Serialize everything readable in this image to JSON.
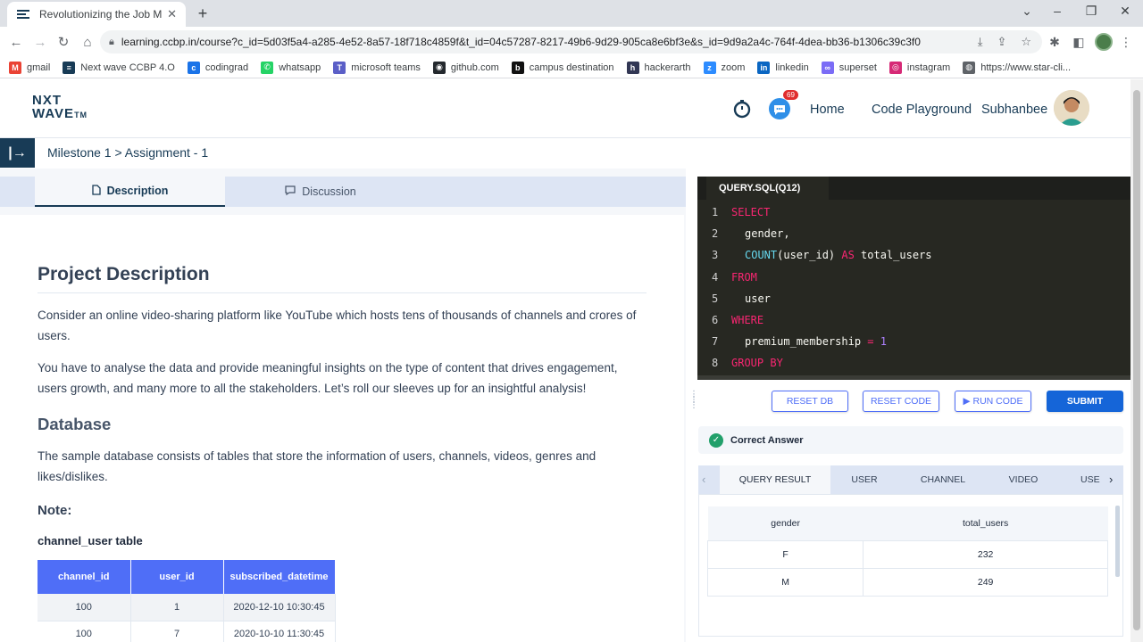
{
  "browser": {
    "tab_title": "Revolutionizing the Job Market |",
    "tab_close": "✕",
    "new_tab": "+",
    "url": "learning.ccbp.in/course?c_id=5d03f5a4-a285-4e52-8a57-18f718c4859f&t_id=04c57287-8217-49b6-9d29-905ca8e6bf3e&s_id=9d9a2a4c-764f-4dea-bb36-b1306c39c3f0",
    "bookmarks": [
      {
        "label": "gmail",
        "icon": "gmail-icon",
        "color": "#ea4335",
        "glyph": "M"
      },
      {
        "label": "Next wave CCBP 4.O",
        "icon": "nxtwave-icon",
        "color": "#183b56",
        "glyph": "≡"
      },
      {
        "label": "codingrad",
        "icon": "codingrad-icon",
        "color": "#1a73e8",
        "glyph": "c"
      },
      {
        "label": "whatsapp",
        "icon": "whatsapp-icon",
        "color": "#25d366",
        "glyph": "✆"
      },
      {
        "label": "microsoft teams",
        "icon": "teams-icon",
        "color": "#5b5fc7",
        "glyph": "T"
      },
      {
        "label": "github.com",
        "icon": "github-icon",
        "color": "#24292e",
        "glyph": "◉"
      },
      {
        "label": "campus destination",
        "icon": "campus-icon",
        "color": "#111111",
        "glyph": "b"
      },
      {
        "label": "hackerarth",
        "icon": "hackerearth-icon",
        "color": "#323754",
        "glyph": "h"
      },
      {
        "label": "zoom",
        "icon": "zoom-icon",
        "color": "#2d8cff",
        "glyph": "z"
      },
      {
        "label": "linkedin",
        "icon": "linkedin-icon",
        "color": "#0a66c2",
        "glyph": "in"
      },
      {
        "label": "superset",
        "icon": "superset-icon",
        "color": "#7b6cf6",
        "glyph": "∞"
      },
      {
        "label": "instagram",
        "icon": "instagram-icon",
        "color": "#d62976",
        "glyph": "◎"
      },
      {
        "label": "https://www.star-cli...",
        "icon": "globe-icon",
        "color": "#5f6368",
        "glyph": "◍"
      }
    ]
  },
  "header": {
    "logo_top": "NXT",
    "logo_bottom": "WAVE",
    "logo_tm": "TM",
    "chat_badge": "69",
    "nav_home": "Home",
    "nav_playground": "Code Playground",
    "user_name": "Subhanbee"
  },
  "breadcrumb": {
    "text": "Milestone 1 > Assignment - 1",
    "toggle": "|→"
  },
  "left_tabs": {
    "description": "Description",
    "discussion": "Discussion"
  },
  "description": {
    "title": "Project Description",
    "p1": "Consider an online video-sharing platform like YouTube which hosts tens of thousands of channels and crores of users.",
    "p2": "You have to analyse the data and provide meaningful insights on the type of content that drives engagement, users growth, and many more to all the stakeholders. Let’s roll our sleeves up for an insightful analysis!",
    "db_heading": "Database",
    "p3": "The sample database consists of tables that store the information of users, channels, videos, genres and likes/dislikes.",
    "note": "Note:",
    "table_title": "channel_user table",
    "table_headers": [
      "channel_id",
      "user_id",
      "subscribed_datetime"
    ],
    "table_rows": [
      [
        "100",
        "1",
        "2020-12-10 10:30:45"
      ],
      [
        "100",
        "7",
        "2020-10-10 11:30:45"
      ]
    ]
  },
  "editor": {
    "tab": "QUERY.SQL(Q12)",
    "lines": [
      {
        "n": "1",
        "indent": false,
        "tokens": [
          {
            "c": "kw",
            "t": "SELECT"
          }
        ]
      },
      {
        "n": "2",
        "indent": true,
        "tokens": [
          {
            "c": "tx",
            "t": "gender,"
          }
        ]
      },
      {
        "n": "3",
        "indent": true,
        "tokens": [
          {
            "c": "fn",
            "t": "COUNT"
          },
          {
            "c": "tx",
            "t": "(user_id) "
          },
          {
            "c": "kw",
            "t": "AS"
          },
          {
            "c": "tx",
            "t": " total_users"
          }
        ]
      },
      {
        "n": "4",
        "indent": false,
        "tokens": [
          {
            "c": "kw",
            "t": "FROM"
          }
        ]
      },
      {
        "n": "5",
        "indent": true,
        "tokens": [
          {
            "c": "tx",
            "t": "user"
          }
        ]
      },
      {
        "n": "6",
        "indent": false,
        "tokens": [
          {
            "c": "kw",
            "t": "WHERE"
          }
        ]
      },
      {
        "n": "7",
        "indent": true,
        "tokens": [
          {
            "c": "tx",
            "t": "premium_membership "
          },
          {
            "c": "kw",
            "t": "="
          },
          {
            "c": "num",
            "t": " 1"
          }
        ]
      },
      {
        "n": "8",
        "indent": false,
        "tokens": [
          {
            "c": "kw",
            "t": "GROUP BY"
          }
        ]
      }
    ]
  },
  "buttons": {
    "reset_db": "RESET DB",
    "reset_code": "RESET CODE",
    "run_code": "▶ RUN CODE",
    "submit": "SUBMIT"
  },
  "result": {
    "status": "Correct Answer",
    "tabs": [
      "QUERY RESULT",
      "USER",
      "CHANNEL",
      "VIDEO",
      "USE"
    ],
    "headers": [
      "gender",
      "total_users"
    ],
    "rows": [
      [
        "F",
        "232"
      ],
      [
        "M",
        "249"
      ]
    ]
  },
  "colors": {
    "brand": "#183b56",
    "accent": "#4f6ef7",
    "submit": "#1565d8",
    "success": "#22a06b"
  }
}
